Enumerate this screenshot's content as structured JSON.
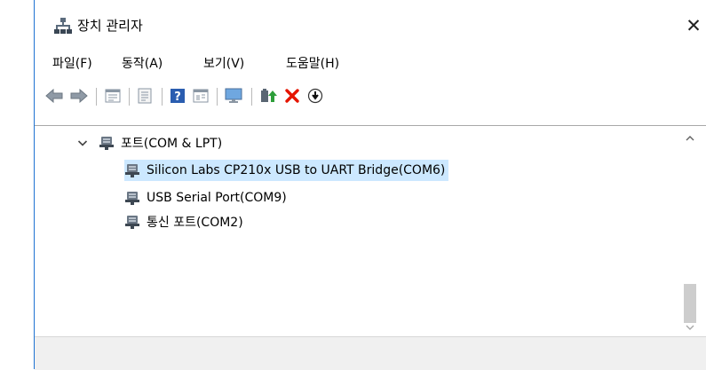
{
  "window": {
    "title": "장치 관리자",
    "close_label": "✕"
  },
  "menu": {
    "file": "파일(F)",
    "action": "동작(A)",
    "view": "보기(V)",
    "help": "도움말(H)"
  },
  "toolbar": {
    "icons": [
      "back-arrow-icon",
      "forward-arrow-icon",
      "properties-grid-icon",
      "document-icon",
      "help-icon",
      "console-tree-icon",
      "monitor-icon",
      "update-driver-icon",
      "remove-device-icon",
      "download-icon"
    ],
    "colors": {
      "remove": "#e51400",
      "help_blue": "#2a5db0",
      "update_green": "#2e9e3a"
    }
  },
  "tree": {
    "category": "포트(COM & LPT)",
    "devices": [
      "Silicon Labs CP210x USB to UART Bridge(COM6)",
      "USB Serial Port(COM9)",
      "통신 포트(COM2)"
    ],
    "selected_index": 0,
    "colors": {
      "selection": "#cce8ff"
    }
  }
}
